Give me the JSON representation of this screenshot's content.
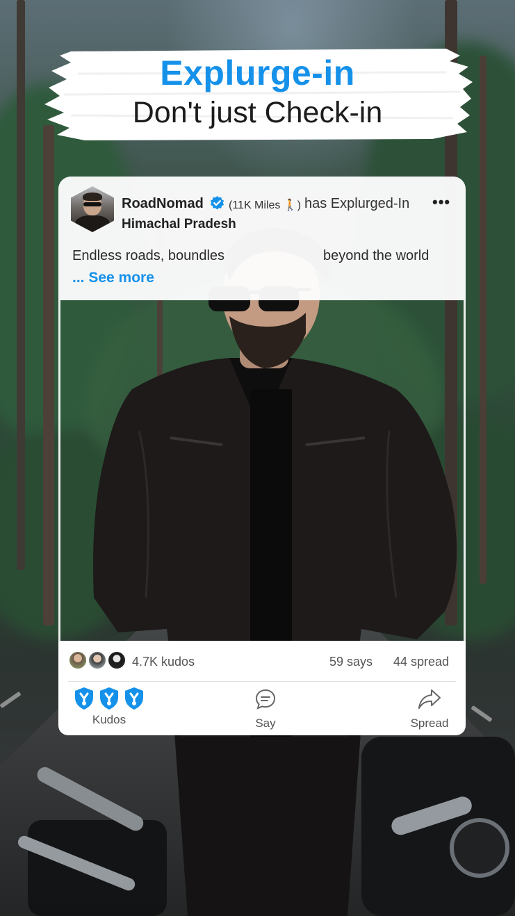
{
  "header": {
    "title": "Explurge-in",
    "subtitle": "Don't just Check-in"
  },
  "post": {
    "username": "RoadNomad",
    "miles": "(11K Miles",
    "miles_close": ")",
    "action": "has Explurged-In",
    "location": "Himachal Pradesh",
    "caption": "Endless roads, boundles",
    "caption_end": "beyond the world",
    "see_more": "... See more",
    "more_menu": "•••"
  },
  "stats": {
    "kudos": "4.7K kudos",
    "says": "59 says",
    "spread": "44 spread"
  },
  "actions": {
    "kudos_label": "Kudos",
    "say_label": "Say",
    "spread_label": "Spread"
  },
  "colors": {
    "accent": "#1591ea",
    "text": "#222222",
    "card": "#ffffff"
  },
  "icons": {
    "verified": "verified-badge-icon",
    "miles": "walking-person-icon",
    "kudos": "kudos-shield-icon",
    "say": "speech-bubble-icon",
    "spread": "share-arrow-icon",
    "more": "more-dots-icon"
  }
}
